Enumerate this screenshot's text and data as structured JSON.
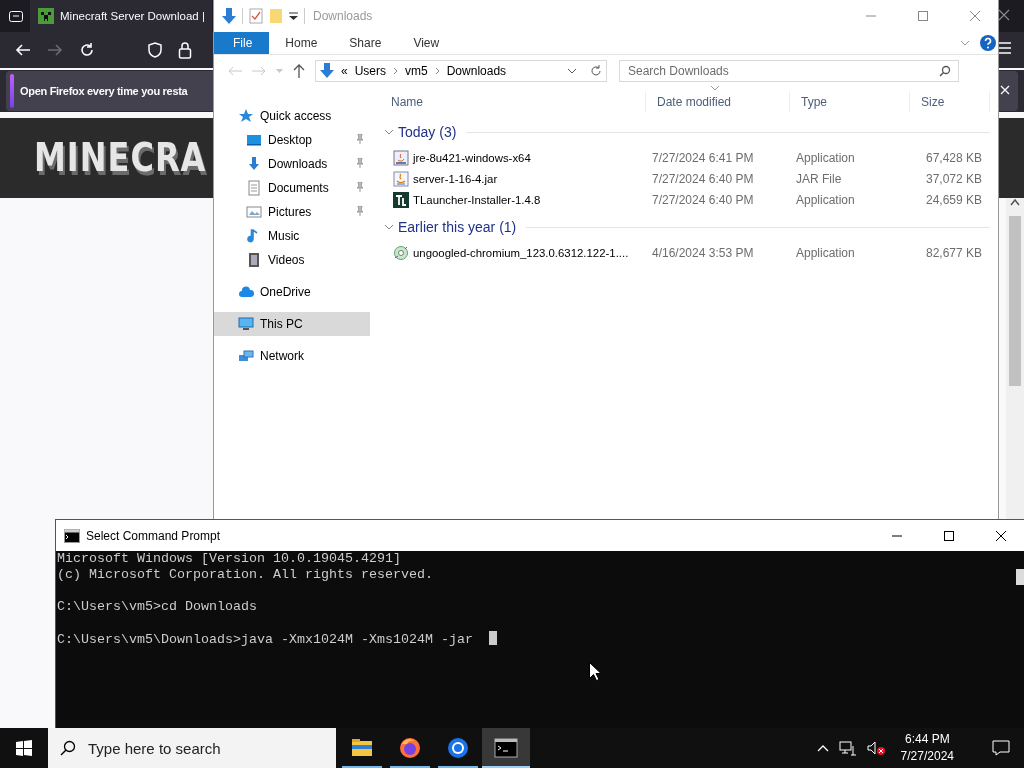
{
  "browser": {
    "tab_title": "Minecraft Server Download |",
    "notification": "Open Firefox every time you resta",
    "logo": "MINECRA"
  },
  "explorer": {
    "title": "Downloads",
    "ribbon_tabs": [
      {
        "label": "File",
        "selected": true
      },
      {
        "label": "Home",
        "selected": false
      },
      {
        "label": "Share",
        "selected": false
      },
      {
        "label": "View",
        "selected": false
      }
    ],
    "address": {
      "overflow": "«",
      "path": [
        "Users",
        "vm5",
        "Downloads"
      ]
    },
    "search": {
      "placeholder": "Search Downloads"
    },
    "nav": [
      {
        "label": "Quick access",
        "kind": "star",
        "selected": false,
        "children": [
          {
            "label": "Desktop",
            "kind": "desktop",
            "pinned": true,
            "selected": false
          },
          {
            "label": "Downloads",
            "kind": "download",
            "pinned": true,
            "selected": false
          },
          {
            "label": "Documents",
            "kind": "document",
            "pinned": true,
            "selected": false
          },
          {
            "label": "Pictures",
            "kind": "pictures",
            "pinned": true,
            "selected": false
          },
          {
            "label": "Music",
            "kind": "music",
            "pinned": false,
            "selected": false
          },
          {
            "label": "Videos",
            "kind": "video",
            "pinned": false,
            "selected": false
          }
        ]
      },
      {
        "label": "OneDrive",
        "kind": "cloud",
        "selected": false
      },
      {
        "label": "This PC",
        "kind": "pc",
        "selected": true
      },
      {
        "label": "Network",
        "kind": "network",
        "selected": false
      }
    ],
    "columns": [
      "Name",
      "Date modified",
      "Type",
      "Size"
    ],
    "groups": [
      {
        "title": "Today (3)",
        "expanded": true,
        "files": [
          {
            "name": "jre-8u421-windows-x64",
            "date": "7/27/2024 6:41 PM",
            "type": "Application",
            "size": "67,428 KB",
            "kind": "installer"
          },
          {
            "name": "server-1-16-4.jar",
            "date": "7/27/2024 6:40 PM",
            "type": "JAR File",
            "size": "37,072 KB",
            "kind": "jar"
          },
          {
            "name": "TLauncher-Installer-1.4.8",
            "date": "7/27/2024 6:40 PM",
            "type": "Application",
            "size": "24,659 KB",
            "kind": "tl"
          }
        ]
      },
      {
        "title": "Earlier this year (1)",
        "expanded": true,
        "files": [
          {
            "name": "ungoogled-chromium_123.0.6312.122-1....",
            "date": "4/16/2024 3:53 PM",
            "type": "Application",
            "size": "82,677 KB",
            "kind": "chromium"
          }
        ]
      }
    ]
  },
  "console": {
    "title": "Select Command Prompt",
    "blocks": [
      [
        "Microsoft Windows [Version 10.0.19045.4291]",
        "(c) Microsoft Corporation. All rights reserved."
      ],
      [
        "C:\\Users\\vm5>cd Downloads"
      ],
      [
        "C:\\Users\\vm5\\Downloads>java -Xmx1024M -Xms1024M -jar"
      ]
    ],
    "cursor": true
  },
  "taskbar": {
    "search_placeholder": "Type here to search",
    "apps": [
      {
        "kind": "explorer",
        "running": true,
        "active": false
      },
      {
        "kind": "firefox",
        "running": true,
        "active": false
      },
      {
        "kind": "chrome",
        "running": true,
        "active": false
      },
      {
        "kind": "terminal",
        "running": true,
        "active": true
      }
    ],
    "time": "6:44 PM",
    "date": "7/27/2024"
  }
}
